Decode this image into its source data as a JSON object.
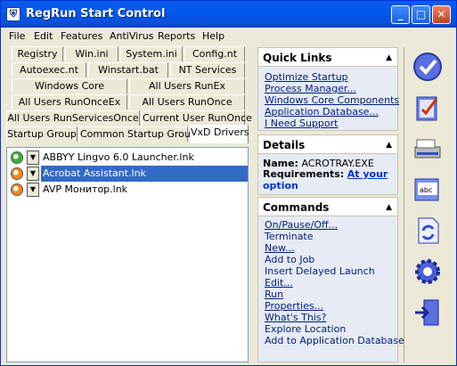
{
  "window": {
    "title": "RegRun Start Control"
  },
  "titlebar_buttons": {
    "minimize": "_",
    "maximize": "□",
    "close": "✕"
  },
  "menu": [
    "File",
    "Edit",
    "Features",
    "AntiVirus",
    "Reports",
    "Help"
  ],
  "tabs": {
    "row1": [
      "Registry",
      "Win.ini",
      "System.ini",
      "Config.nt"
    ],
    "row2": [
      "Autoexec.nt",
      "Winstart.bat",
      "NT Services"
    ],
    "row3": [
      "Windows Core",
      "All Users RunEx"
    ],
    "row4": [
      "All Users RunOnceEx",
      "All Users RunOnce"
    ],
    "row5": [
      "All Users RunServicesOnce",
      "Current User RunOnce"
    ],
    "row6": [
      "Startup Group",
      "Common Startup Group",
      "VxD Drivers"
    ]
  },
  "startup_items": [
    {
      "label": "ABBYY Lingvo 6.0 Launcher.lnk",
      "status": "green"
    },
    {
      "label": "Acrobat Assistant.lnk",
      "status": "orange",
      "selected": true
    },
    {
      "label": "AVP Монитор.lnk",
      "status": "orange"
    }
  ],
  "status_colors": {
    "green": "#36b336",
    "orange": "#f08a18",
    "selection": "#316ac5"
  },
  "quick_links": {
    "title": "Quick Links",
    "items": [
      "Optimize Startup",
      "Process Manager...",
      "Windows Core Components",
      "Application Database...",
      "I Need Support"
    ]
  },
  "details": {
    "title": "Details",
    "name_label": "Name:",
    "name_value": "ACROTRAY.EXE",
    "req_label": "Requirements:",
    "req_value_1": "At your",
    "req_value_2": "option"
  },
  "commands": {
    "title": "Commands",
    "items": [
      "On/Pause/Off...",
      "Terminate",
      "New...",
      "Add to Job",
      "Insert Delayed Launch",
      "Edit...",
      "Run",
      "Properties...",
      "What's This?",
      "Explore Location",
      "Add to Application Database"
    ]
  },
  "toolbar_icons": [
    "check-circle-icon",
    "checklist-icon",
    "scanner-icon",
    "spell-check-icon",
    "document-refresh-icon",
    "gear-icon",
    "exit-door-icon"
  ]
}
